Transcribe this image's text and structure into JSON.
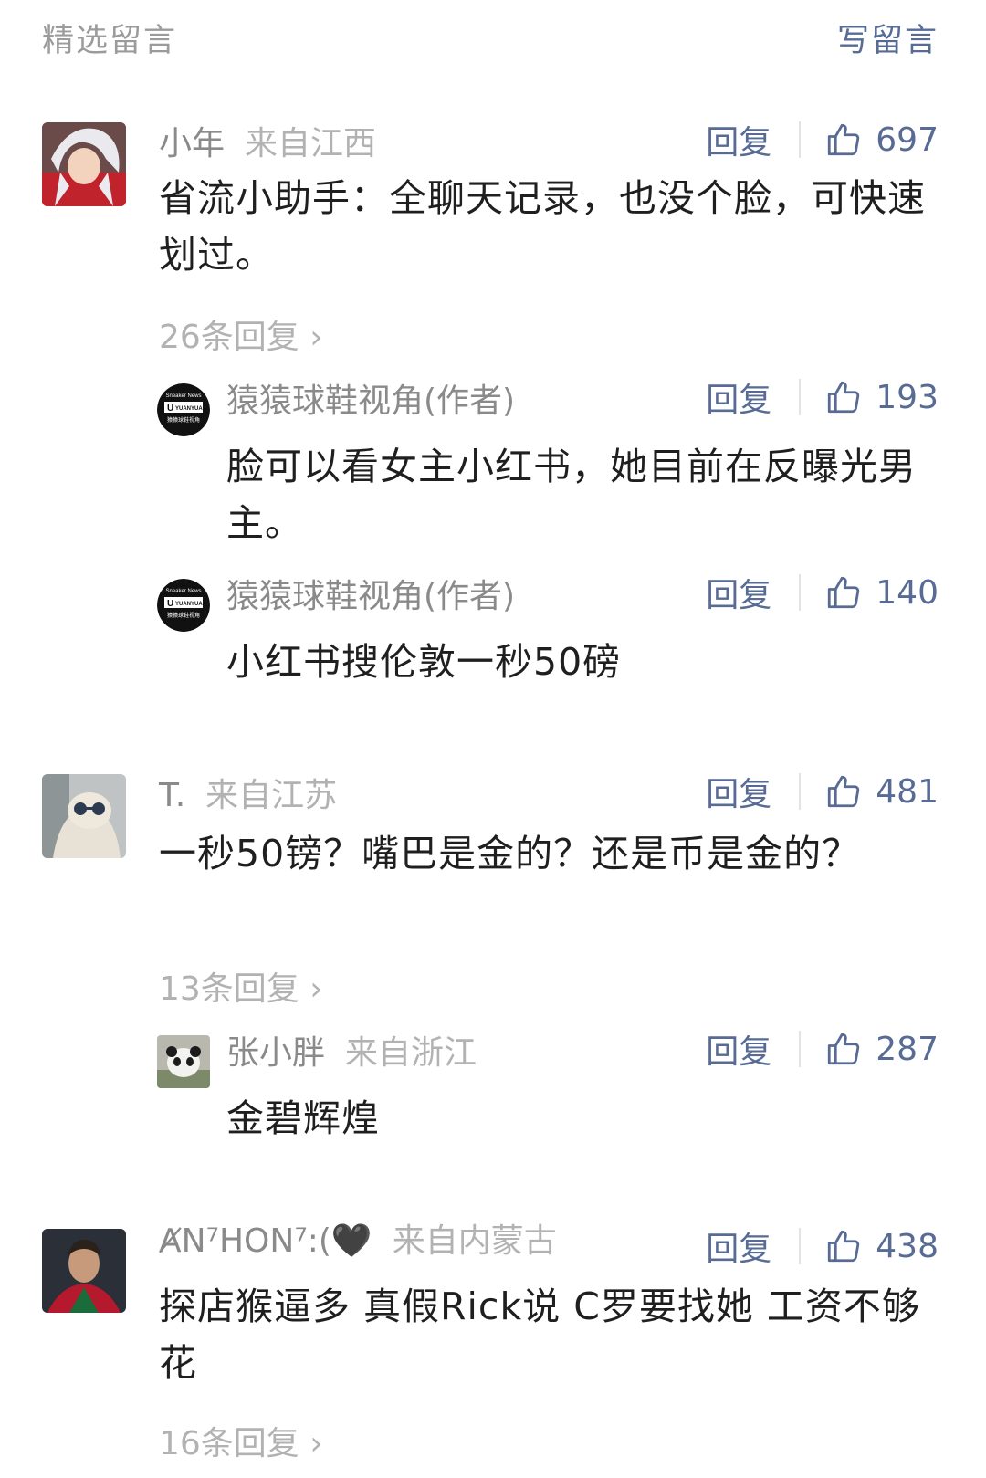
{
  "header": {
    "title": "精选留言",
    "write": "写留言"
  },
  "comments": [
    {
      "name": "小年",
      "location": "来自江西",
      "reply": "回复",
      "likes": "697",
      "text": "省流小助手：全聊天记录，也没个脸，可快速划过。",
      "more": "26条回复",
      "replies": [
        {
          "name": "猿猿球鞋视角(作者)",
          "reply": "回复",
          "likes": "193",
          "text": "脸可以看女主小红书，她目前在反曝光男主。"
        },
        {
          "name": "猿猿球鞋视角(作者)",
          "reply": "回复",
          "likes": "140",
          "text": "小红书搜伦敦一秒50磅"
        }
      ]
    },
    {
      "name": "T.",
      "location": "来自江苏",
      "reply": "回复",
      "likes": "481",
      "text": "一秒50镑？嘴巴是金的？还是币是金的？",
      "more": "13条回复",
      "replies": [
        {
          "name": "张小胖",
          "location": "来自浙江",
          "reply": "回复",
          "likes": "287",
          "text": "金碧辉煌"
        }
      ]
    },
    {
      "name": "ȺN⁷HON⁷:(🖤",
      "location": "来自内蒙古",
      "reply": "回复",
      "likes": "438",
      "text": "探店猴逼多 真假Rick说 C罗要找她 工资不够花",
      "more": "16条回复"
    }
  ],
  "logo": {
    "line1": "Sneaker News",
    "line2": "YUANYUAN",
    "line3": "猿猿球鞋视角"
  },
  "icons": {
    "like": "thumbs-up-icon",
    "chevron": "chevron-right-icon"
  },
  "colors": {
    "link": "#576b95",
    "muted": "#b2b2b2",
    "name": "#8a8a8a",
    "text": "#1f1f1f"
  }
}
